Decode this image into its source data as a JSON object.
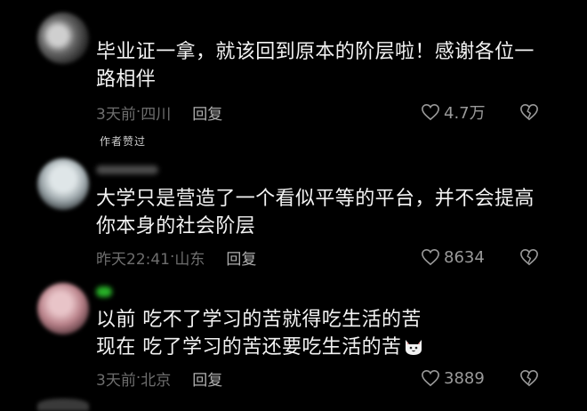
{
  "comments": [
    {
      "text_lines": [
        "毕业证一拿，就该回到原本的阶层啦！感谢各位一",
        "路相伴"
      ],
      "time": "3天前",
      "location": "四川",
      "reply_label": "回复",
      "likes": "4.7万",
      "badge": "作者赞过",
      "like_icon": "heart-outline-icon",
      "dislike_icon": "broken-heart-icon"
    },
    {
      "text_lines": [
        "大学只是营造了一个看似平等的平台，并不会提高",
        "你本身的社会阶层"
      ],
      "time": "昨天22:41",
      "location": "山东",
      "reply_label": "回复",
      "likes": "8634",
      "like_icon": "heart-outline-icon",
      "dislike_icon": "broken-heart-icon"
    },
    {
      "text_lines": [
        "以前 吃不了学习的苦就得吃生活的苦",
        "现在 吃了学习的苦还要吃生活的苦"
      ],
      "emoji": "cat-face-emoji",
      "time": "3天前",
      "location": "北京",
      "reply_label": "回复",
      "likes": "3889",
      "like_icon": "heart-outline-icon",
      "dislike_icon": "broken-heart-icon"
    }
  ],
  "colors": {
    "background": "#000000",
    "text": "#f3f3f3",
    "meta": "#6e6e6e",
    "icon": "#9a9a9a"
  }
}
